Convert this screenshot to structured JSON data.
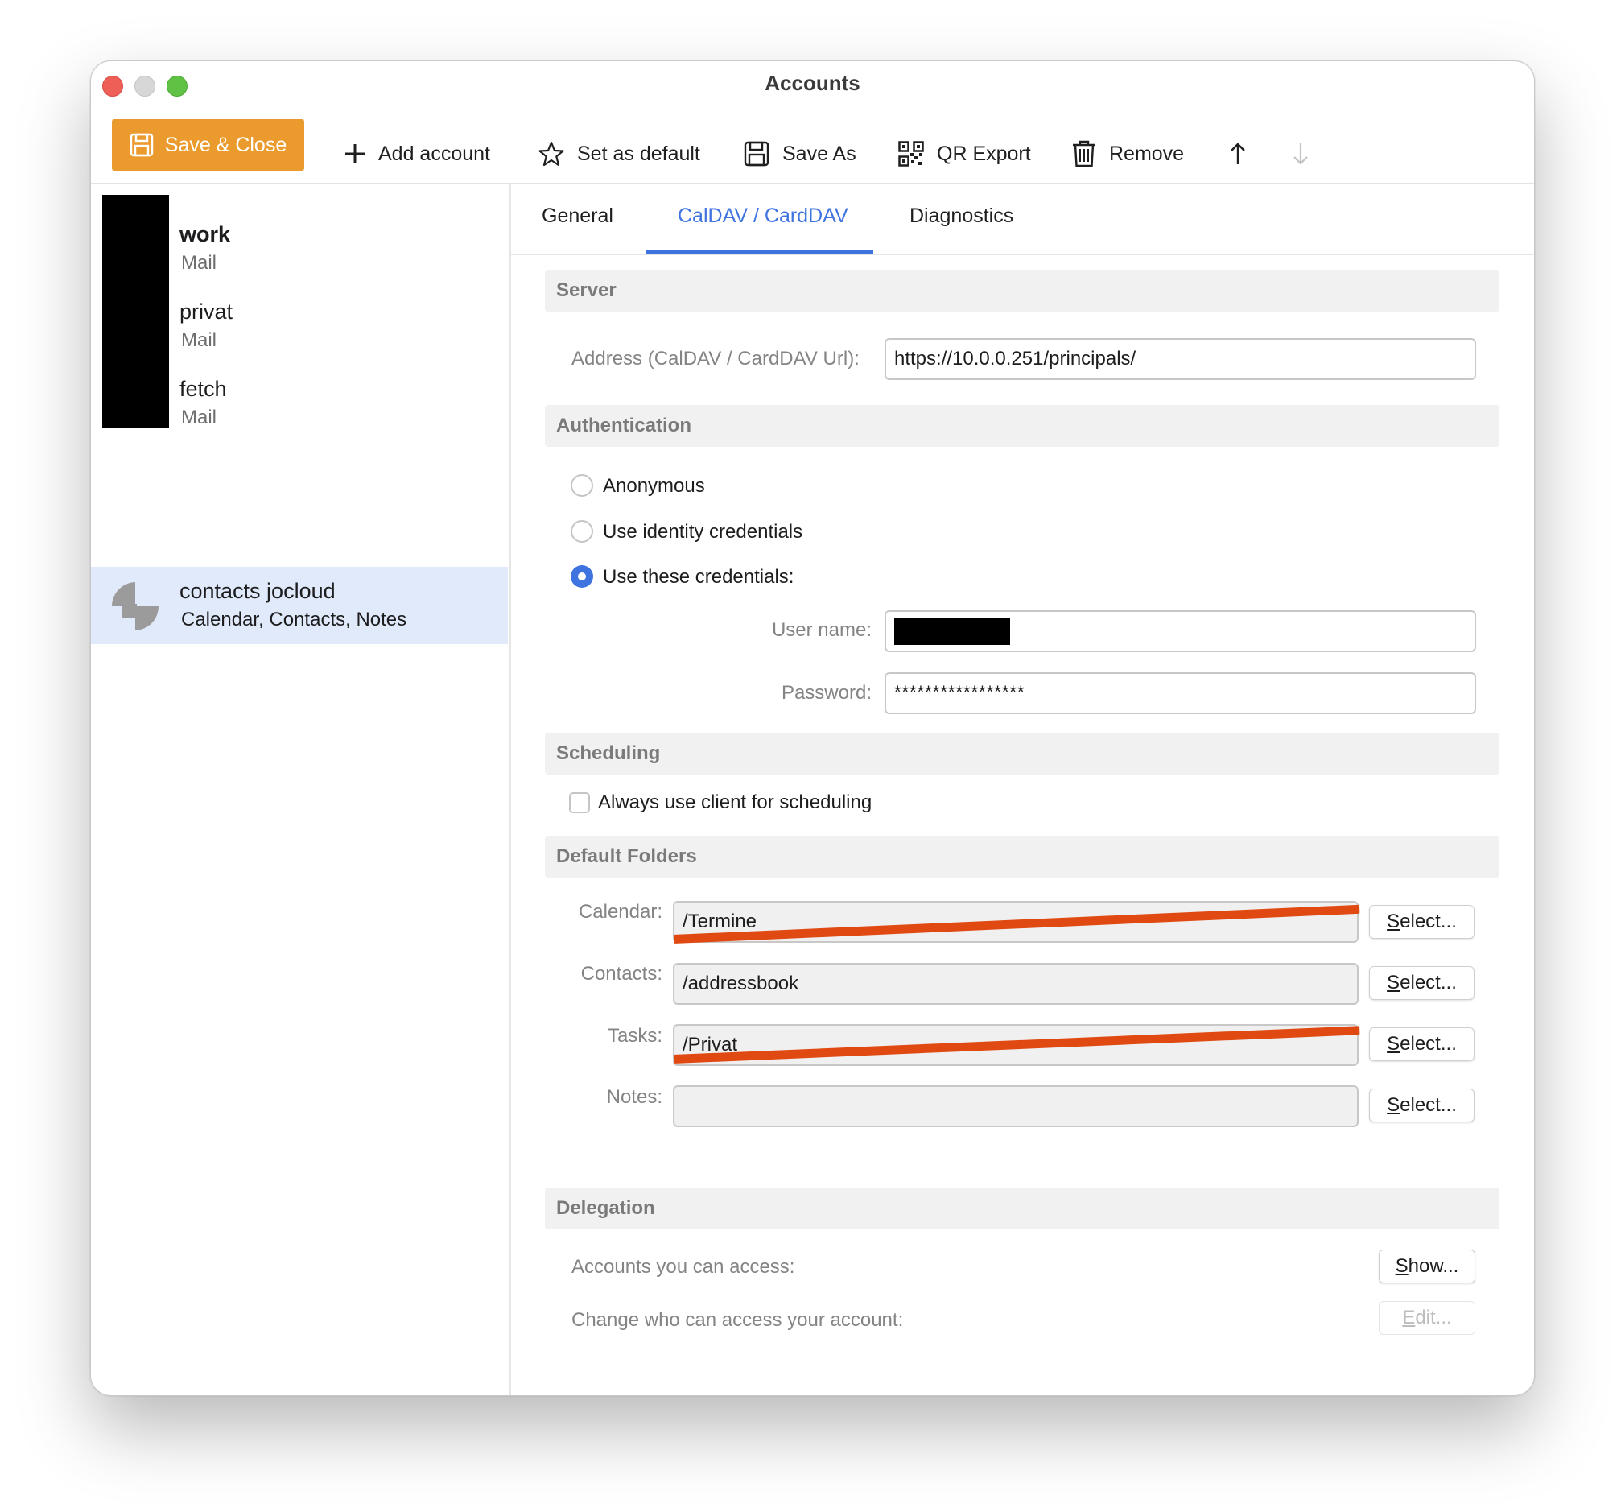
{
  "window": {
    "title": "Accounts",
    "colors": {
      "close": "#ee5f57",
      "minimize": "#d7d7d7",
      "zoom": "#5fc245",
      "accent": "#3f74e0",
      "primary_button": "#eb9b2e",
      "strike": "#e04a12"
    }
  },
  "toolbar": {
    "save_close": "Save & Close",
    "add_account": "Add account",
    "set_default": "Set as default",
    "save_as": "Save As",
    "qr_export": "QR Export",
    "remove": "Remove",
    "move_up_icon": "arrow-up-icon",
    "move_down_icon": "arrow-down-icon"
  },
  "sidebar": {
    "accounts": [
      {
        "name": "work",
        "type": "Mail"
      },
      {
        "name": "privat",
        "type": "Mail"
      },
      {
        "name": "fetch",
        "type": "Mail"
      },
      {
        "name": "contacts jocloud",
        "type": "Calendar, Contacts, Notes",
        "selected": true
      }
    ]
  },
  "tabs": [
    {
      "label": "General",
      "active": false
    },
    {
      "label": "CalDAV / CardDAV",
      "active": true
    },
    {
      "label": "Diagnostics",
      "active": false
    }
  ],
  "server": {
    "heading": "Server",
    "address_label": "Address (CalDAV / CardDAV Url):",
    "address_value": "https://10.0.0.251/principals/"
  },
  "authentication": {
    "heading": "Authentication",
    "options": [
      "Anonymous",
      "Use identity credentials",
      "Use these credentials:"
    ],
    "selected_index": 2,
    "username_label": "User name:",
    "password_label": "Password:",
    "password_value": "*****************"
  },
  "scheduling": {
    "heading": "Scheduling",
    "always_client_label": "Always use client for scheduling",
    "always_client_checked": false
  },
  "default_folders": {
    "heading": "Default Folders",
    "select_first": "S",
    "select_rest": "elect...",
    "rows": [
      {
        "label": "Calendar:",
        "value": "/Termine"
      },
      {
        "label": "Contacts:",
        "value": "/addressbook"
      },
      {
        "label": "Tasks:",
        "value": "/Privat"
      },
      {
        "label": "Notes:",
        "value": ""
      }
    ]
  },
  "delegation": {
    "heading": "Delegation",
    "accounts_access_label": "Accounts you can access:",
    "show_first": "S",
    "show_rest": "how...",
    "change_access_label": "Change who can access your account:",
    "edit_first": "E",
    "edit_rest": "dit..."
  }
}
